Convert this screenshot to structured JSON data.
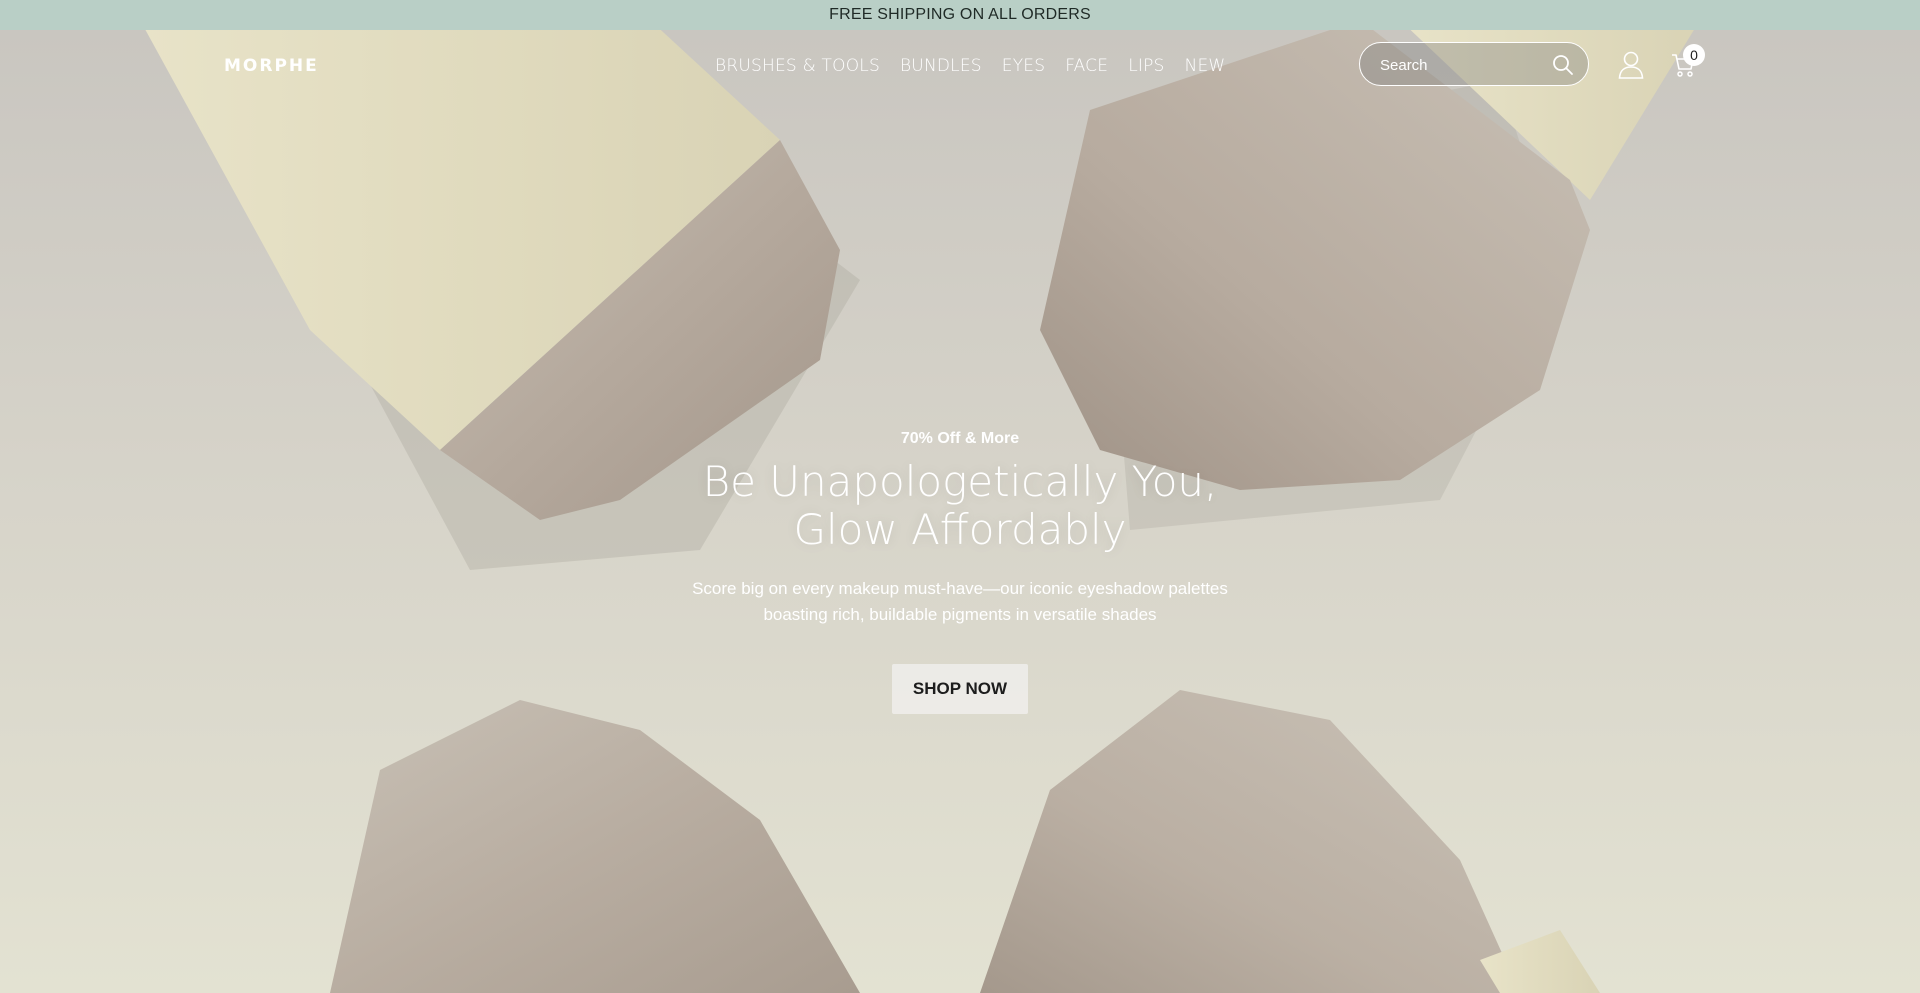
{
  "announcement": "FREE SHIPPING ON ALL ORDERS",
  "logo": "MORPHE",
  "nav": [
    "BRUSHES & TOOLS",
    "BUNDLES",
    "EYES",
    "FACE",
    "LIPS",
    "NEW"
  ],
  "search": {
    "placeholder": "Search"
  },
  "cart": {
    "count": "0"
  },
  "hero": {
    "eyebrow": "70% Off & More",
    "headline": "Be Unapologetically You, Glow Affordably",
    "subtext": "Score big on every makeup must-have—our iconic eyeshadow palettes boasting rich, buildable pigments in versatile shades",
    "cta": "SHOP NOW"
  },
  "colors": {
    "announcement_bg": "#b9cfc6",
    "brush_handle": "#e4dfc4",
    "bristles": "#b8aea3"
  },
  "icons": [
    "search-icon",
    "account-icon",
    "cart-icon"
  ]
}
